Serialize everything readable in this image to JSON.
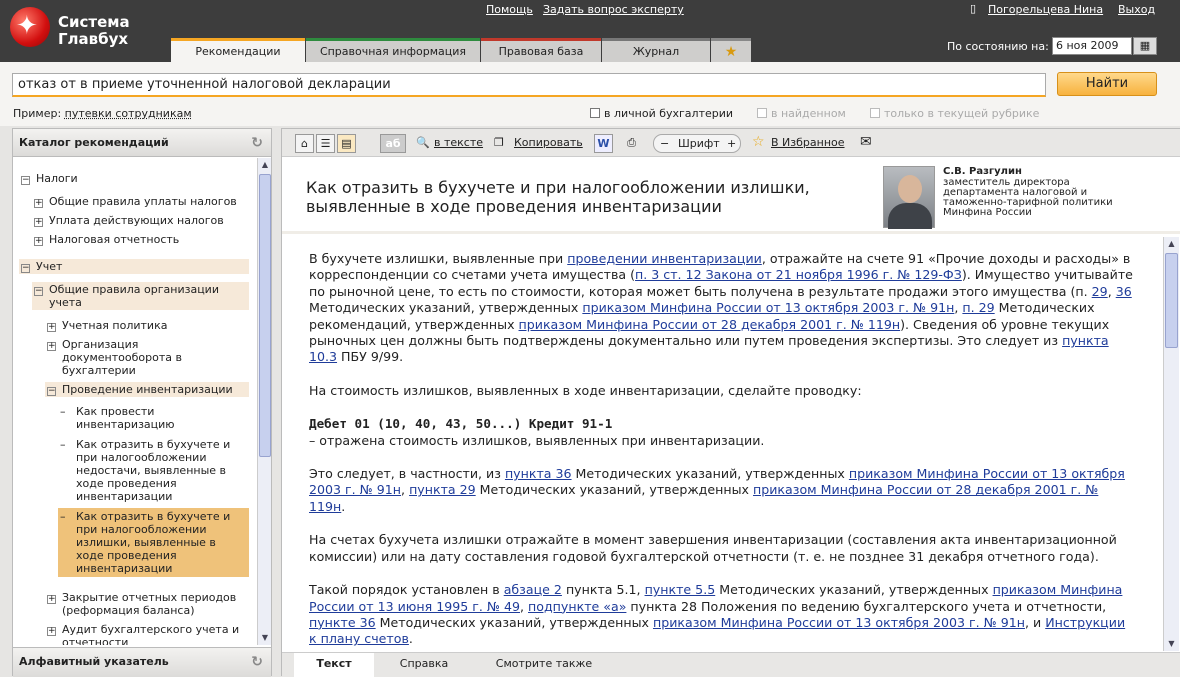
{
  "app": {
    "logo_line1": "Система",
    "logo_line2": "Главбух"
  },
  "toplinks": {
    "help": "Помощь",
    "ask_expert": "Задать вопрос эксперту",
    "user": "Погорельцева Нина",
    "exit": "Выход"
  },
  "tabs": [
    "Рекомендации",
    "Справочная информация",
    "Правовая база",
    "Журнал"
  ],
  "date": {
    "label": "По состоянию на:",
    "value": "6 ноя 2009"
  },
  "search": {
    "query": "отказ от в приеме уточненной налоговой декларации",
    "button": "Найти",
    "example_label": "Пример:",
    "example_link": "путевки сотрудникам",
    "options": [
      "в личной бухгалтерии",
      "в найденном",
      "только в текущей рубрике"
    ]
  },
  "catalog": {
    "title": "Каталог рекомендаций",
    "alpha_title": "Алфавитный указатель",
    "items": [
      {
        "sign": "−",
        "text": "Налоги"
      },
      {
        "sign": "+",
        "text": "Общие правила уплаты налогов"
      },
      {
        "sign": "+",
        "text": "Уплата действующих налогов"
      },
      {
        "sign": "+",
        "text": "Налоговая отчетность"
      },
      {
        "sign": "−",
        "text": "Учет"
      },
      {
        "sign": "−",
        "text": "Общие правила организации учета"
      },
      {
        "sign": "+",
        "text": "Учетная политика"
      },
      {
        "sign": "+",
        "text": "Организация документооборота в бухгалтерии"
      },
      {
        "sign": "−",
        "text": "Проведение инвентаризации"
      },
      {
        "sign": "–",
        "text": "Как провести инвентаризацию"
      },
      {
        "sign": "–",
        "text": "Как отразить в бухучете и при налогообложении недостачи, выявленные в ходе проведения инвентаризации"
      },
      {
        "sign": "–",
        "text": "Как отразить в бухучете и при налогообложении излишки, выявленные в ходе проведения инвентаризации"
      },
      {
        "sign": "+",
        "text": "Закрытие отчетных периодов (реформация баланса)"
      },
      {
        "sign": "+",
        "text": "Аудит бухгалтерского учета и отчетности"
      }
    ]
  },
  "toolbar": {
    "ab": "аб",
    "in_text": "в тексте",
    "copy": "Копировать",
    "font": "Шрифт",
    "minus": "−",
    "plus": "+",
    "favorites": "В Избранное"
  },
  "article": {
    "title": "Как отразить в бухучете и при налогообложении излишки, выявленные в ходе проведения инвентаризации",
    "author_name": "С.В. Разгулин",
    "author_role": "заместитель директора департамента налоговой и таможенно-тарифной политики Минфина России",
    "p1": [
      {
        "t": "В бухучете излишки, выявленные при "
      },
      {
        "a": "проведении инвентаризации"
      },
      {
        "t": ", отражайте на счете 91 «Прочие доходы и расходы» в корреспонденции со счетами учета имущества ("
      },
      {
        "a": "п. 3 ст. 12 Закона от 21 ноября 1996 г. № 129-ФЗ"
      },
      {
        "t": "). Имущество учитывайте по рыночной цене, то есть по стоимости, которая может быть получена в результате продажи этого имущества (п. "
      },
      {
        "a": "29"
      },
      {
        "t": ", "
      },
      {
        "a": "36"
      },
      {
        "t": " Методических указаний, утвержденных "
      },
      {
        "a": "приказом Минфина России от 13 октября 2003 г. № 91н"
      },
      {
        "t": ", "
      },
      {
        "a": "п. 29"
      },
      {
        "t": " Методических рекомендаций, утвержденных "
      },
      {
        "a": "приказом Минфина России от 28 декабря 2001 г. № 119н"
      },
      {
        "t": "). Сведения об уровне текущих рыночных цен должны быть подтверждены документально или путем проведения экспертизы. Это следует из "
      },
      {
        "a": "пункта 10.3"
      },
      {
        "t": " ПБУ 9/99."
      }
    ],
    "p2": "На стоимость излишков, выявленных в ходе инвентаризации, сделайте проводку:",
    "entry": "Дебет 01 (10, 40, 43, 50...) Кредит 91-1",
    "entry_desc": "– отражена стоимость излишков, выявленных при инвентаризации.",
    "p3": [
      {
        "t": "Это следует, в частности, из "
      },
      {
        "a": "пункта 36"
      },
      {
        "t": " Методических указаний, утвержденных "
      },
      {
        "a": "приказом Минфина России от 13 октября 2003 г. № 91н"
      },
      {
        "t": ", "
      },
      {
        "a": "пункта 29"
      },
      {
        "t": " Методических указаний, утвержденных "
      },
      {
        "a": "приказом Минфина России от 28 декабря 2001 г. № 119н"
      },
      {
        "t": "."
      }
    ],
    "p4": "На счетах бухучета излишки отражайте в момент завершения инвентаризации (составления акта инвентаризационной комиссии) или на дату составления годовой бухгалтерской отчетности (т. е. не позднее 31 декабря отчетного года).",
    "p5": [
      {
        "t": "Такой порядок установлен в "
      },
      {
        "a": "абзаце 2"
      },
      {
        "t": " пункта 5.1, "
      },
      {
        "a": "пункте 5.5"
      },
      {
        "t": " Методических указаний, утвержденных "
      },
      {
        "a": "приказом Минфина России от 13 июня 1995 г. № 49"
      },
      {
        "t": ", "
      },
      {
        "a": "подпункте «а»"
      },
      {
        "t": " пункта 28 Положения по ведению бухгалтерского учета и отчетности, "
      },
      {
        "a": "пункте 36"
      },
      {
        "t": " Методических указаний, утвержденных "
      },
      {
        "a": "приказом Минфина России от 13 октября 2003 г. № 91н"
      },
      {
        "t": ", и "
      },
      {
        "a": "Инструкции к плану счетов"
      },
      {
        "t": "."
      }
    ]
  },
  "bottom_tabs": [
    "Текст",
    "Справка",
    "Смотрите также"
  ]
}
